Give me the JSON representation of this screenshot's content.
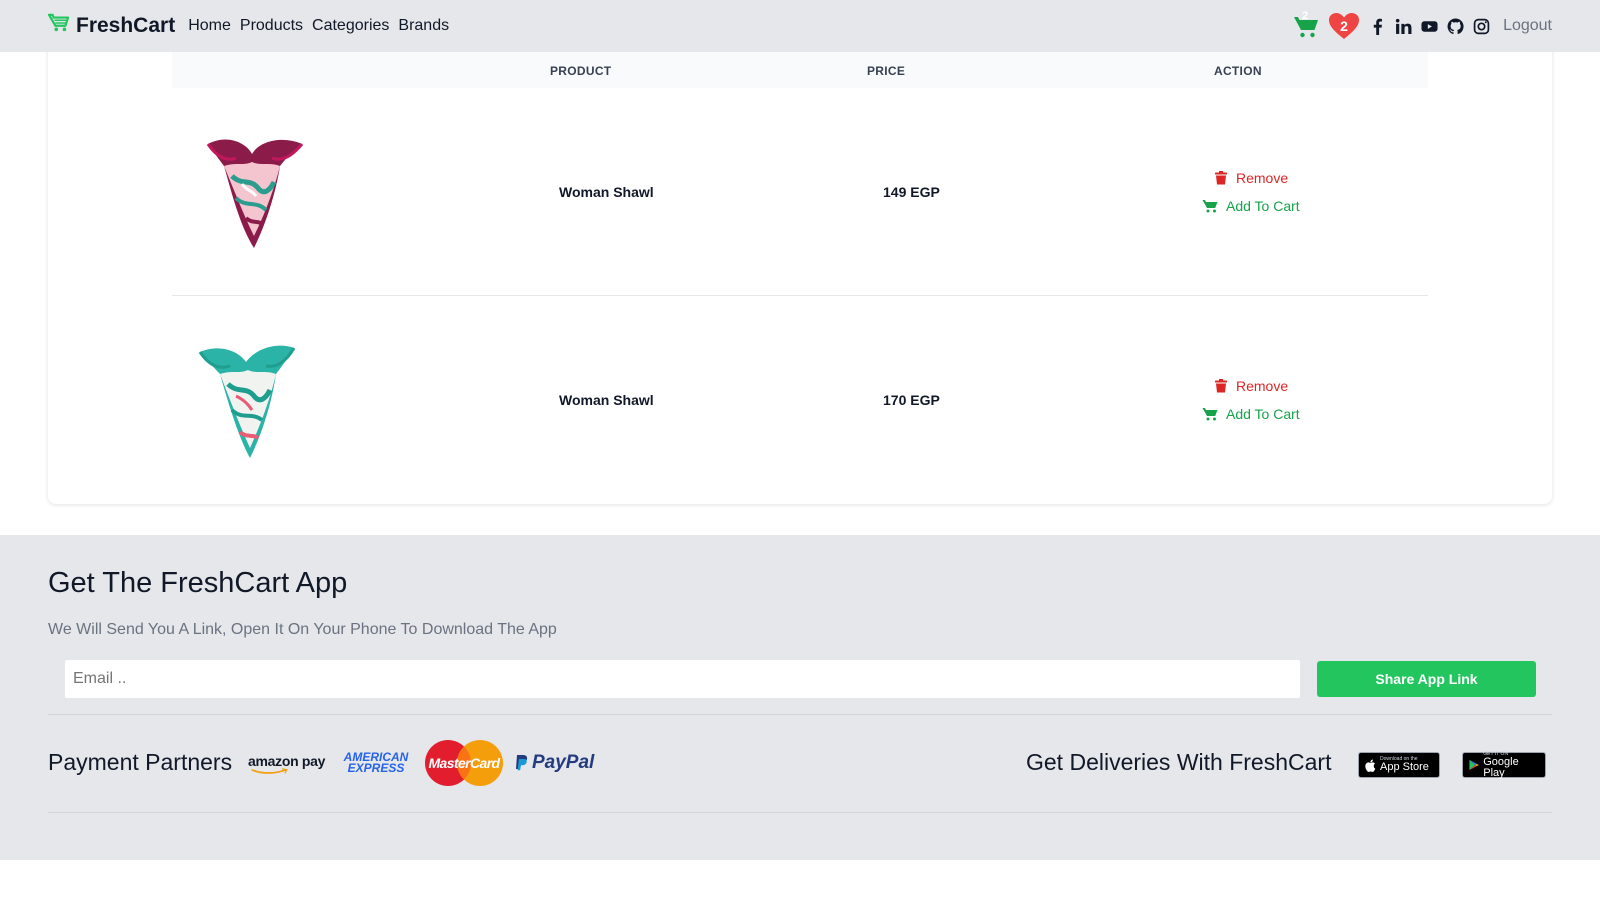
{
  "nav": {
    "brand": "FreshCart",
    "links": [
      "Home",
      "Products",
      "Categories",
      "Brands"
    ],
    "cart_count": "2",
    "wishlist_count": "2",
    "logout": "Logout",
    "social_icons": [
      "facebook-icon",
      "linkedin-icon",
      "youtube-icon",
      "github-icon",
      "instagram-icon"
    ]
  },
  "wishlist": {
    "headers": [
      "",
      "PRODUCT",
      "PRICE",
      "ACTION"
    ],
    "items": [
      {
        "name": "Woman Shawl",
        "price": "149 EGP",
        "remove": "Remove",
        "add": "Add To Cart",
        "image": "shawl-magenta"
      },
      {
        "name": "Woman Shawl",
        "price": "170 EGP",
        "remove": "Remove",
        "add": "Add To Cart",
        "image": "shawl-teal"
      }
    ]
  },
  "footer": {
    "title": "Get The FreshCart App",
    "subtitle": "We Will Send You A Link, Open It On Your Phone To Download The App",
    "email_placeholder": "Email ..",
    "share_button": "Share App Link",
    "payment_title": "Payment Partners",
    "payment_logos": [
      "amazon pay",
      "AMERICAN EXPRESS",
      "MasterCard",
      "PayPal"
    ],
    "deliveries_title": "Get Deliveries With FreshCart",
    "app_store": {
      "small": "Download on the",
      "big": "App Store"
    },
    "google_play": {
      "small": "GET IT ON",
      "big": "Google Play"
    }
  },
  "colors": {
    "brand_green": "#22c55e",
    "remove_red": "#dc2626",
    "heart_red": "#ef4444",
    "footer_bg": "#e5e7eb"
  }
}
